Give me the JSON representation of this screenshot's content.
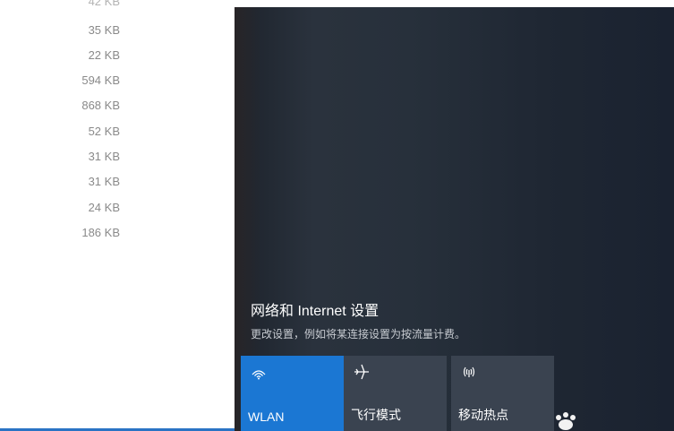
{
  "file_list": {
    "sizes": [
      "35 KB",
      "22 KB",
      "594 KB",
      "868 KB",
      "52 KB",
      "31 KB",
      "31 KB",
      "24 KB",
      "186 KB"
    ]
  },
  "network_panel": {
    "title": "网络和 Internet 设置",
    "subtitle": "更改设置，例如将某连接设置为按流量计费。"
  },
  "quick_actions": [
    {
      "label": "WLAN",
      "icon": "wifi-icon",
      "active": true
    },
    {
      "label": "飞行模式",
      "icon": "airplane-icon",
      "active": false
    },
    {
      "label": "移动热点",
      "icon": "mobile-hotspot-icon",
      "active": false
    }
  ],
  "colors": {
    "accent": "#1b77d3",
    "tile_inactive": "#3a4350",
    "flyout_bg": "#252d38"
  }
}
